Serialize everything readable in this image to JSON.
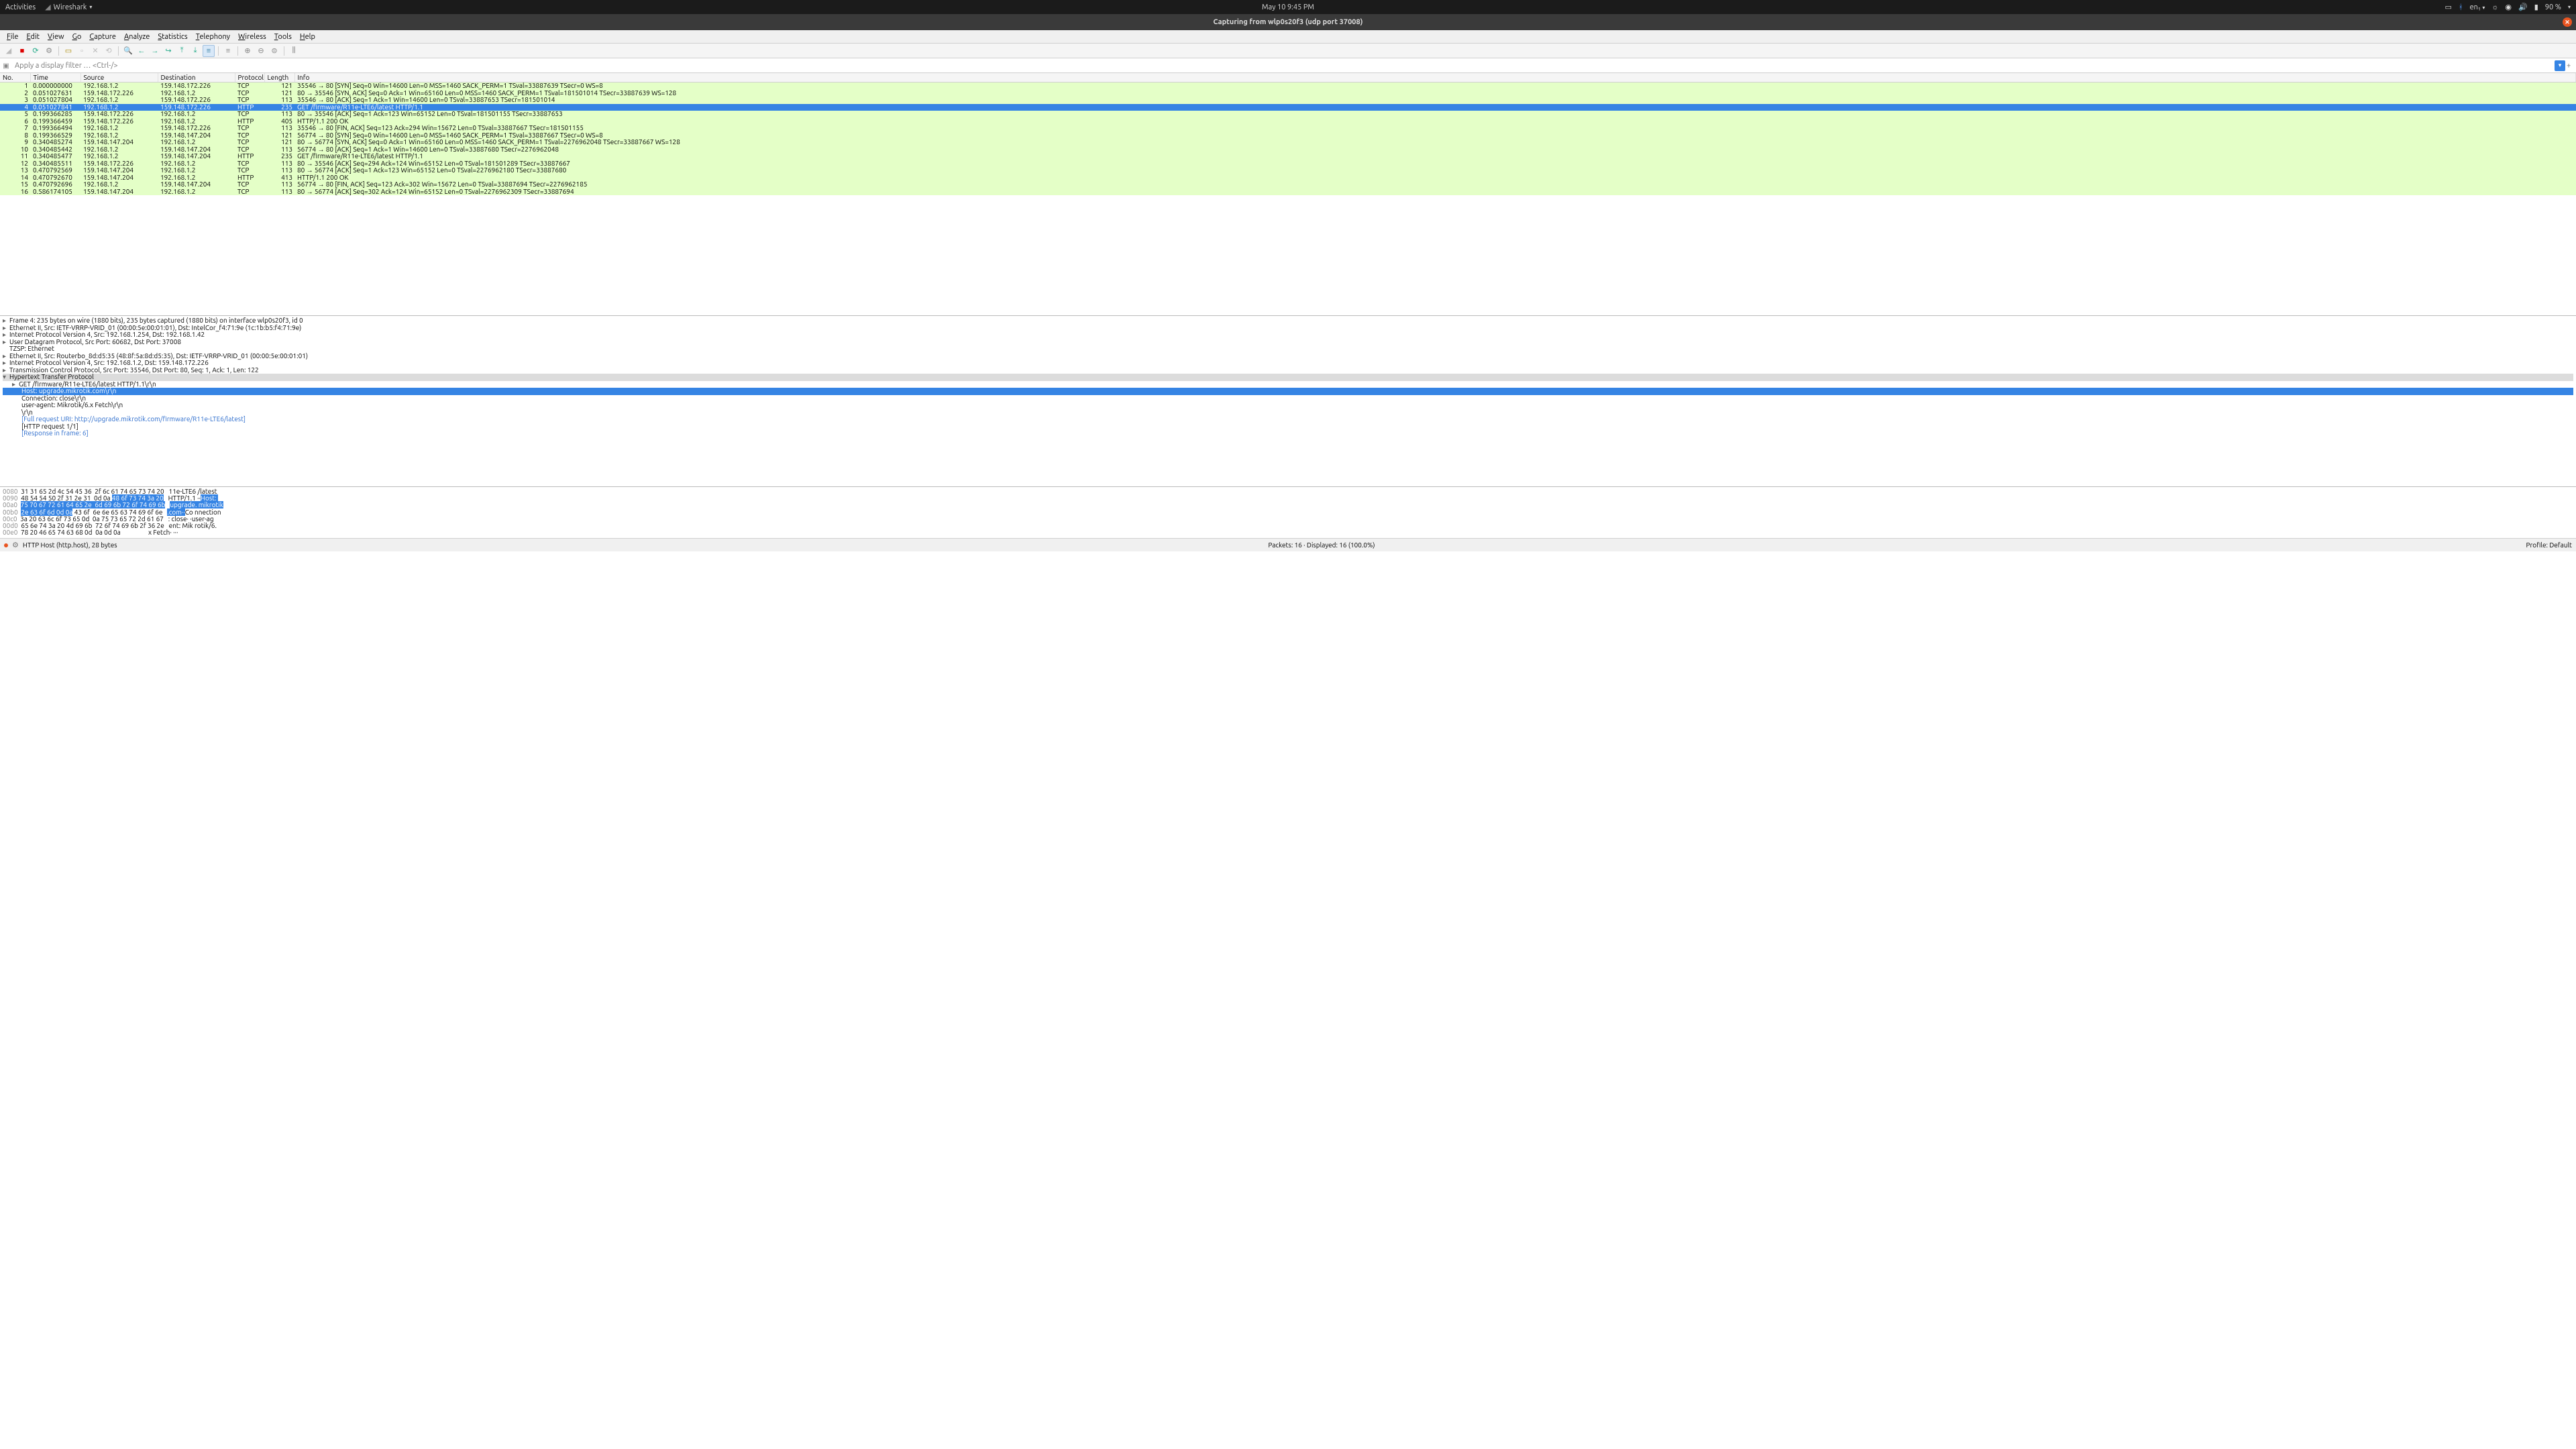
{
  "topbar": {
    "activities": "Activities",
    "app_name": "Wireshark",
    "datetime": "May 10  9:45 PM",
    "lang": "en₁",
    "battery": "90 %"
  },
  "titlebar": {
    "title": "Capturing from wlp0s20f3 (udp port 37008)"
  },
  "menus": [
    "File",
    "Edit",
    "View",
    "Go",
    "Capture",
    "Analyze",
    "Statistics",
    "Telephony",
    "Wireless",
    "Tools",
    "Help"
  ],
  "filter": {
    "placeholder": "Apply a display filter … <Ctrl-/>"
  },
  "columns": [
    "No.",
    "Time",
    "Source",
    "Destination",
    "Protocol",
    "Length",
    "Info"
  ],
  "packets": [
    {
      "no": "1",
      "time": "0.000000000",
      "src": "192.168.1.2",
      "dst": "159.148.172.226",
      "proto": "TCP",
      "len": "121",
      "info": "35546 → 80 [SYN] Seq=0 Win=14600 Len=0 MSS=1460 SACK_PERM=1 TSval=33887639 TSecr=0 WS=8"
    },
    {
      "no": "2",
      "time": "0.051027631",
      "src": "159.148.172.226",
      "dst": "192.168.1.2",
      "proto": "TCP",
      "len": "121",
      "info": "80 → 35546 [SYN, ACK] Seq=0 Ack=1 Win=65160 Len=0 MSS=1460 SACK_PERM=1 TSval=181501014 TSecr=33887639 WS=128"
    },
    {
      "no": "3",
      "time": "0.051027804",
      "src": "192.168.1.2",
      "dst": "159.148.172.226",
      "proto": "TCP",
      "len": "113",
      "info": "35546 → 80 [ACK] Seq=1 Ack=1 Win=14600 Len=0 TSval=33887653 TSecr=181501014"
    },
    {
      "no": "4",
      "time": "0.051027841",
      "src": "192.168.1.2",
      "dst": "159.148.172.226",
      "proto": "HTTP",
      "len": "235",
      "info": "GET /firmware/R11e-LTE6/latest HTTP/1.1 ",
      "selected": true
    },
    {
      "no": "5",
      "time": "0.199366285",
      "src": "159.148.172.226",
      "dst": "192.168.1.2",
      "proto": "TCP",
      "len": "113",
      "info": "80 → 35546 [ACK] Seq=1 Ack=123 Win=65152 Len=0 TSval=181501155 TSecr=33887653"
    },
    {
      "no": "6",
      "time": "0.199366459",
      "src": "159.148.172.226",
      "dst": "192.168.1.2",
      "proto": "HTTP",
      "len": "405",
      "info": "HTTP/1.1 200 OK "
    },
    {
      "no": "7",
      "time": "0.199366494",
      "src": "192.168.1.2",
      "dst": "159.148.172.226",
      "proto": "TCP",
      "len": "113",
      "info": "35546 → 80 [FIN, ACK] Seq=123 Ack=294 Win=15672 Len=0 TSval=33887667 TSecr=181501155"
    },
    {
      "no": "8",
      "time": "0.199366529",
      "src": "192.168.1.2",
      "dst": "159.148.147.204",
      "proto": "TCP",
      "len": "121",
      "info": "56774 → 80 [SYN] Seq=0 Win=14600 Len=0 MSS=1460 SACK_PERM=1 TSval=33887667 TSecr=0 WS=8"
    },
    {
      "no": "9",
      "time": "0.340485274",
      "src": "159.148.147.204",
      "dst": "192.168.1.2",
      "proto": "TCP",
      "len": "121",
      "info": "80 → 56774 [SYN, ACK] Seq=0 Ack=1 Win=65160 Len=0 MSS=1460 SACK_PERM=1 TSval=2276962048 TSecr=33887667 WS=128"
    },
    {
      "no": "10",
      "time": "0.340485442",
      "src": "192.168.1.2",
      "dst": "159.148.147.204",
      "proto": "TCP",
      "len": "113",
      "info": "56774 → 80 [ACK] Seq=1 Ack=1 Win=14600 Len=0 TSval=33887680 TSecr=2276962048"
    },
    {
      "no": "11",
      "time": "0.340485477",
      "src": "192.168.1.2",
      "dst": "159.148.147.204",
      "proto": "HTTP",
      "len": "235",
      "info": "GET /firmware/R11e-LTE6/latest HTTP/1.1 "
    },
    {
      "no": "12",
      "time": "0.340485511",
      "src": "159.148.172.226",
      "dst": "192.168.1.2",
      "proto": "TCP",
      "len": "113",
      "info": "80 → 35546 [ACK] Seq=294 Ack=124 Win=65152 Len=0 TSval=181501289 TSecr=33887667"
    },
    {
      "no": "13",
      "time": "0.470792569",
      "src": "159.148.147.204",
      "dst": "192.168.1.2",
      "proto": "TCP",
      "len": "113",
      "info": "80 → 56774 [ACK] Seq=1 Ack=123 Win=65152 Len=0 TSval=2276962180 TSecr=33887680"
    },
    {
      "no": "14",
      "time": "0.470792670",
      "src": "159.148.147.204",
      "dst": "192.168.1.2",
      "proto": "HTTP",
      "len": "413",
      "info": "HTTP/1.1 200 OK "
    },
    {
      "no": "15",
      "time": "0.470792696",
      "src": "192.168.1.2",
      "dst": "159.148.147.204",
      "proto": "TCP",
      "len": "113",
      "info": "56774 → 80 [FIN, ACK] Seq=123 Ack=302 Win=15672 Len=0 TSval=33887694 TSecr=2276962185"
    },
    {
      "no": "16",
      "time": "0.586174105",
      "src": "159.148.147.204",
      "dst": "192.168.1.2",
      "proto": "TCP",
      "len": "113",
      "info": "80 → 56774 [ACK] Seq=302 Ack=124 Win=65152 Len=0 TSval=2276962309 TSecr=33887694"
    }
  ],
  "tree": {
    "frame": "Frame 4: 235 bytes on wire (1880 bits), 235 bytes captured (1880 bits) on interface wlp0s20f3, id 0",
    "eth1": "Ethernet II, Src: IETF-VRRP-VRID_01 (00:00:5e:00:01:01), Dst: IntelCor_f4:71:9e (1c:1b:b5:f4:71:9e)",
    "ip1": "Internet Protocol Version 4, Src: 192.168.1.254, Dst: 192.168.1.42",
    "udp": "User Datagram Protocol, Src Port: 60682, Dst Port: 37008",
    "tzsp": "TZSP: Ethernet",
    "eth2": "Ethernet II, Src: Routerbo_8d:d5:35 (48:8f:5a:8d:d5:35), Dst: IETF-VRRP-VRID_01 (00:00:5e:00:01:01)",
    "ip2": "Internet Protocol Version 4, Src: 192.168.1.2, Dst: 159.148.172.226",
    "tcp": "Transmission Control Protocol, Src Port: 35546, Dst Port: 80, Seq: 1, Ack: 1, Len: 122",
    "http": "Hypertext Transfer Protocol",
    "get": "GET /firmware/R11e-LTE6/latest HTTP/1.1\\r\\n",
    "host": "Host: upgrade.mikrotik.com\\r\\n",
    "conn": "Connection: close\\r\\n",
    "ua": "user-agent: Mikrotik/6.x Fetch\\r\\n",
    "crlf": "\\r\\n",
    "full_uri": "[Full request URI: http://upgrade.mikrotik.com/firmware/R11e-LTE6/latest]",
    "http_req": "[HTTP request 1/1]",
    "resp_in": "[Response in frame: 6]"
  },
  "hex": [
    {
      "off": "0080",
      "hex": "31 31 65 2d 4c 54 45 36  2f 6c 61 74 65 73 74 20",
      "ascii": "11e-LTE6 /latest "
    },
    {
      "off": "0090",
      "hex_pre": "48 54 54 50 2f 31 2e 31  0d 0a ",
      "hex_hl": "48 6f 73 74 3a 20",
      "ascii_pre": "HTTP/1.1 ··",
      "ascii_hl": "Host: "
    },
    {
      "off": "00a0",
      "hex_hl": "75 70 67 72 61 64 65 2e  6d 69 6b 72 6f 74 69 6b",
      "ascii_hl": "upgrade. mikrotik"
    },
    {
      "off": "00b0",
      "hex_hl": "2e 63 6f 6d 0d 0a",
      "hex_post": " 43 6f  6e 6e 65 63 74 69 6f 6e",
      "ascii_hl": ".com··",
      "ascii_post": "Co nnection"
    },
    {
      "off": "00c0",
      "hex": "3a 20 63 6c 6f 73 65 0d  0a 75 73 65 72 2d 61 67",
      "ascii": ": close· ·user-ag"
    },
    {
      "off": "00d0",
      "hex": "65 6e 74 3a 20 4d 69 6b  72 6f 74 69 6b 2f 36 2e",
      "ascii": "ent: Mik rotik/6."
    },
    {
      "off": "00e0",
      "hex": "78 20 46 65 74 63 68 0d  0a 0d 0a",
      "ascii": "x Fetch· ···"
    }
  ],
  "status": {
    "left": "HTTP Host (http.host), 28 bytes",
    "center": "Packets: 16 · Displayed: 16 (100.0%)",
    "right": "Profile: Default"
  }
}
